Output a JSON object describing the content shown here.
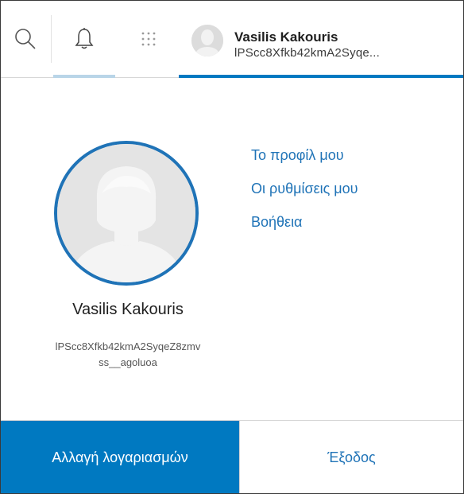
{
  "header": {
    "user_name": "Vasilis Kakouris",
    "user_id_truncated": "lPScc8Xfkb42kmA2Syqe..."
  },
  "profile": {
    "name": "Vasilis Kakouris",
    "id_line1": "lPScc8Xfkb42kmA2SyqeZ8zmv",
    "id_line2": "ss__agoluoa"
  },
  "links": {
    "my_profile": "Το προφίλ μου",
    "my_settings": "Οι ρυθμίσεις μου",
    "help": "Βοήθεια"
  },
  "buttons": {
    "switch_accounts": "Αλλαγή λογαριασμών",
    "sign_out": "Έξοδος"
  },
  "icons": {
    "search": "search-icon",
    "bell": "bell-icon",
    "apps": "apps-grid-icon",
    "avatar": "user-avatar"
  },
  "colors": {
    "accent": "#0079c1",
    "link": "#1f73b7",
    "active_tab_light": "#b9d5e8"
  }
}
